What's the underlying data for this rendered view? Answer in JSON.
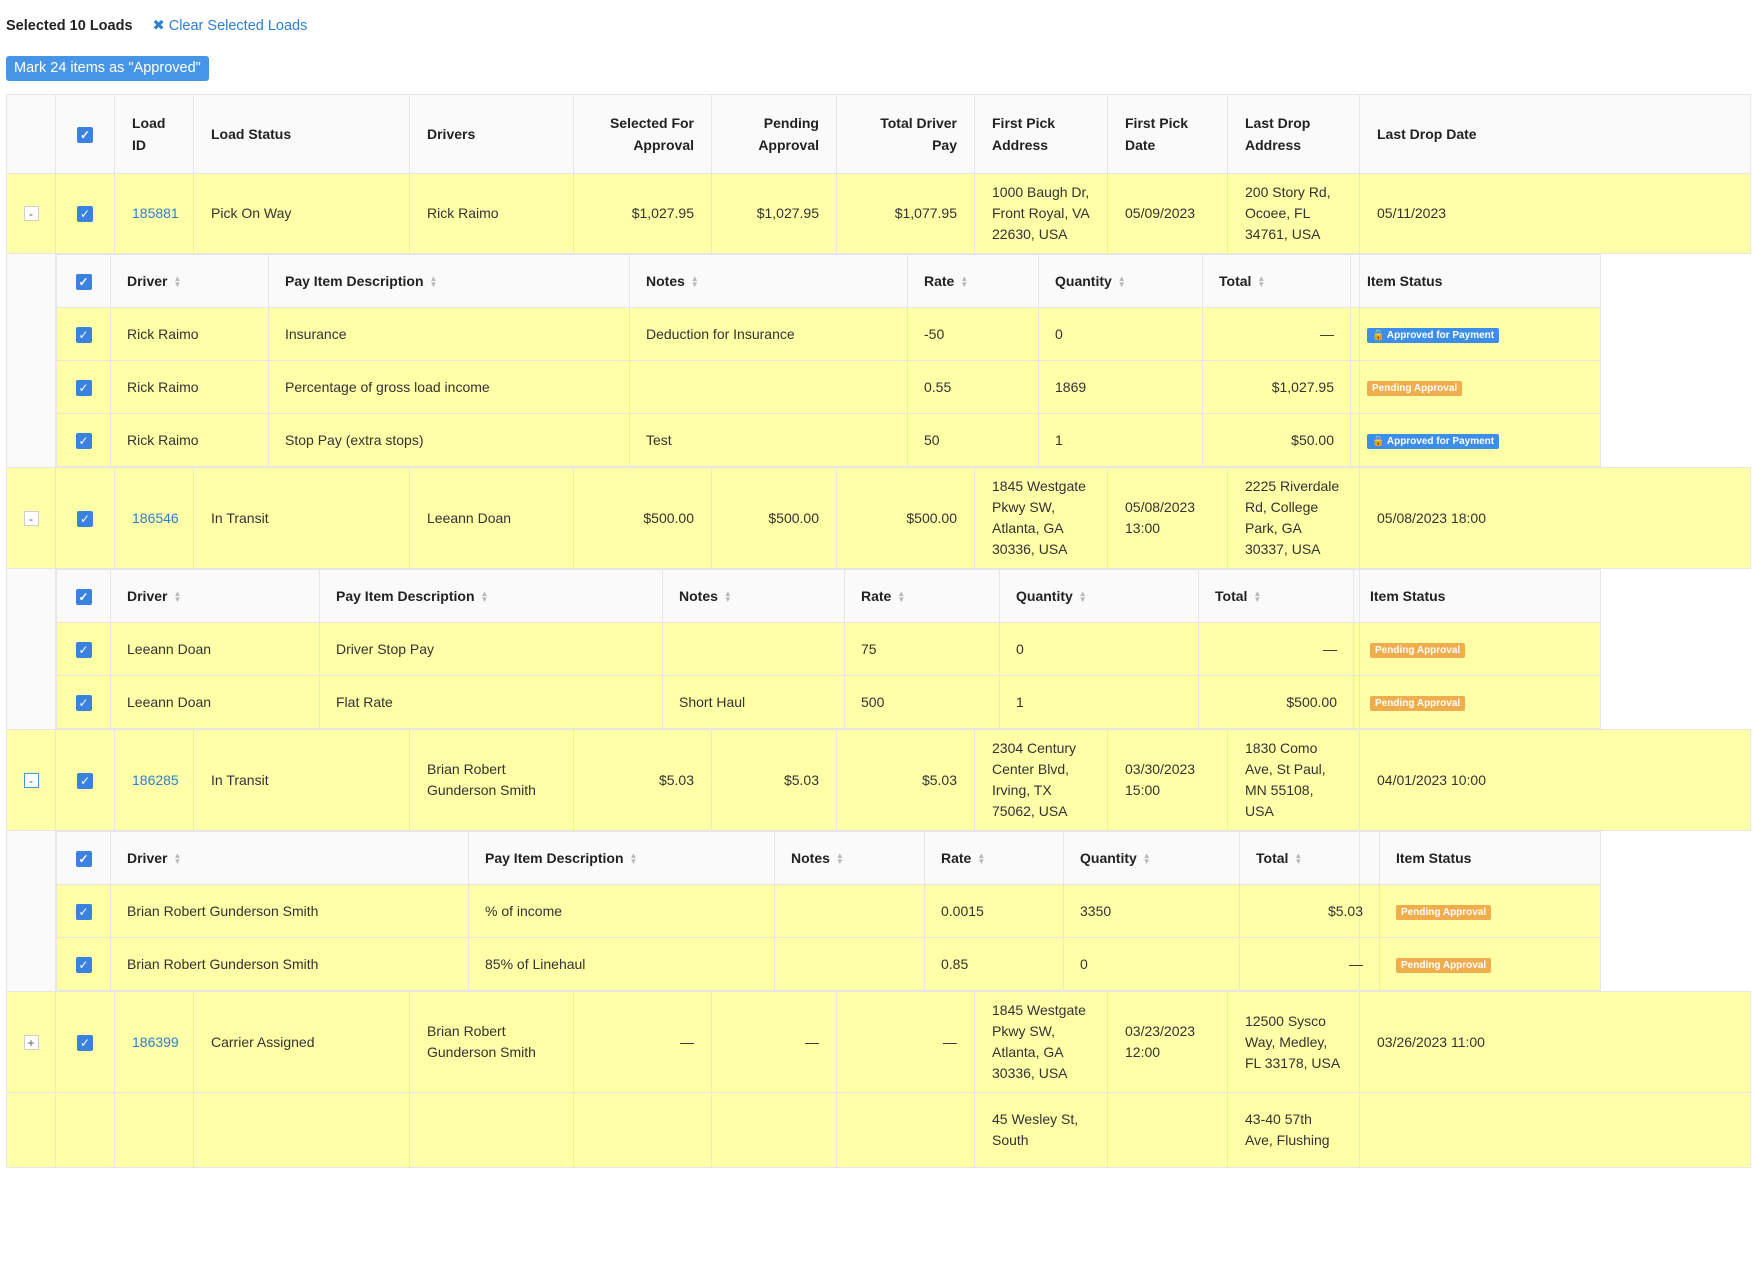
{
  "header": {
    "selected_label": "Selected 10 Loads",
    "clear_icon": "✖",
    "clear_label": "Clear Selected Loads",
    "approve_button": "Mark 24 items as \"Approved\""
  },
  "columns": {
    "load_id": "Load ID",
    "load_status": "Load Status",
    "drivers": "Drivers",
    "selected_for_approval": "Selected For Approval",
    "pending_approval": "Pending Approval",
    "total_driver_pay": "Total Driver Pay",
    "first_pick_address": "First Pick Address",
    "first_pick_date": "First Pick Date",
    "last_drop_address": "Last Drop Address",
    "last_drop_date": "Last Drop Date"
  },
  "sub_columns": {
    "driver": "Driver",
    "pay_item_description": "Pay Item Description",
    "notes": "Notes",
    "rate": "Rate",
    "quantity": "Quantity",
    "total": "Total",
    "item_status": "Item Status"
  },
  "colors": {
    "row_highlight": "#ffffa8",
    "link": "#2d7fd3",
    "badge_approved": "#3d8ee8",
    "badge_pending": "#f0ad4e"
  },
  "loads": [
    {
      "expand": "-",
      "id": "185881",
      "status": "Pick On Way",
      "drivers": "Rick Raimo",
      "selected": "$1,027.95",
      "pending": "$1,027.95",
      "total": "$1,077.95",
      "first_pick_address": "1000 Baugh Dr, Front Royal, VA 22630, USA",
      "first_pick_date": "05/09/2023",
      "last_drop_address": "200 Story Rd, Ocoee, FL 34761, USA",
      "last_drop_date": "05/11/2023",
      "items": [
        {
          "driver": "Rick Raimo",
          "desc": "Insurance",
          "notes": "Deduction for Insurance",
          "rate": "-50",
          "qty": "0",
          "total": "—",
          "status": "🔒 Approved for Payment",
          "status_type": "pay"
        },
        {
          "driver": "Rick Raimo",
          "desc": "Percentage of gross load income",
          "notes": "",
          "rate": "0.55",
          "qty": "1869",
          "total": "$1,027.95",
          "status": "Pending Approval",
          "status_type": "pend"
        },
        {
          "driver": "Rick Raimo",
          "desc": "Stop Pay (extra stops)",
          "notes": "Test",
          "rate": "50",
          "qty": "1",
          "total": "$50.00",
          "status": "🔒 Approved for Payment",
          "status_type": "pay"
        }
      ]
    },
    {
      "expand": "-",
      "id": "186546",
      "status": "In Transit",
      "drivers": "Leeann Doan",
      "selected": "$500.00",
      "pending": "$500.00",
      "total": "$500.00",
      "first_pick_address": "1845 Westgate Pkwy SW, Atlanta, GA 30336, USA",
      "first_pick_date": "05/08/2023 13:00",
      "last_drop_address": "2225 Riverdale Rd, College Park, GA 30337, USA",
      "last_drop_date": "05/08/2023 18:00",
      "items": [
        {
          "driver": "Leeann Doan",
          "desc": "Driver Stop Pay",
          "notes": "",
          "rate": "75",
          "qty": "0",
          "total": "—",
          "status": "Pending Approval",
          "status_type": "pend"
        },
        {
          "driver": "Leeann Doan",
          "desc": "Flat Rate",
          "notes": "Short Haul",
          "rate": "500",
          "qty": "1",
          "total": "$500.00",
          "status": "Pending Approval",
          "status_type": "pend"
        }
      ]
    },
    {
      "expand": "-",
      "id": "186285",
      "status": "In Transit",
      "drivers": "Brian Robert Gunderson Smith",
      "selected": "$5.03",
      "pending": "$5.03",
      "total": "$5.03",
      "first_pick_address": "2304 Century Center Blvd, Irving, TX 75062, USA",
      "first_pick_date": "03/30/2023 15:00",
      "last_drop_address": "1830 Como Ave, St Paul, MN 55108, USA",
      "last_drop_date": "04/01/2023 10:00",
      "items": [
        {
          "driver": "Brian Robert Gunderson Smith",
          "desc": "% of income",
          "notes": "",
          "rate": "0.0015",
          "qty": "3350",
          "total": "$5.03",
          "status": "Pending Approval",
          "status_type": "pend"
        },
        {
          "driver": "Brian Robert Gunderson Smith",
          "desc": "85% of Linehaul",
          "notes": "",
          "rate": "0.85",
          "qty": "0",
          "total": "—",
          "status": "Pending Approval",
          "status_type": "pend"
        }
      ]
    },
    {
      "expand": "+",
      "id": "186399",
      "status": "Carrier Assigned",
      "drivers": "Brian Robert Gunderson Smith",
      "selected": "—",
      "pending": "—",
      "total": "—",
      "first_pick_address": "1845 Westgate Pkwy SW, Atlanta, GA 30336, USA",
      "first_pick_date": "03/23/2023 12:00",
      "last_drop_address": "12500 Sysco Way, Medley, FL 33178, USA",
      "last_drop_date": "03/26/2023 11:00",
      "items": []
    },
    {
      "expand": "",
      "id": "",
      "status": "",
      "drivers": "",
      "selected": "",
      "pending": "",
      "total": "",
      "first_pick_address": "45 Wesley St, South",
      "first_pick_date": "",
      "last_drop_address": "43-40 57th Ave, Flushing",
      "last_drop_date": "",
      "items": []
    }
  ]
}
